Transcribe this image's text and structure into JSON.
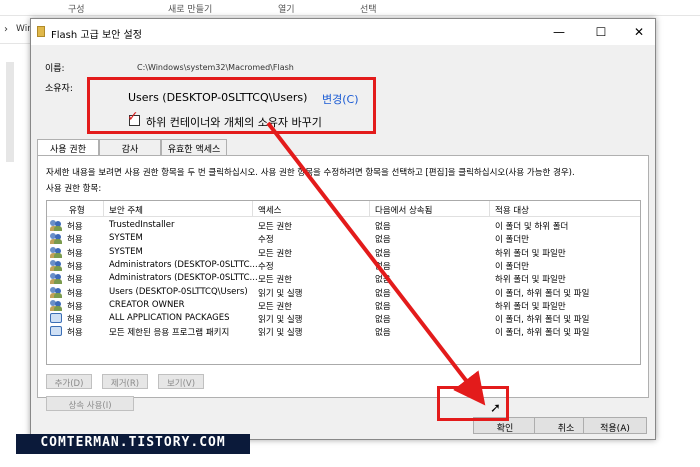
{
  "background": {
    "ribbon": [
      "구성",
      "새로 만들기",
      "열기",
      "선택"
    ],
    "address_fragment": "Wir"
  },
  "dialog": {
    "title": "Flash 고급 보안 설정",
    "name_label": "이름:",
    "name_value": "C:\\Windows\\system32\\Macromed\\Flash",
    "owner_label": "소유자:",
    "owner_value": "Users (DESKTOP-0SLTTCQ\\Users)",
    "owner_change_link": "변경(C)",
    "replace_owner_checkbox": {
      "label": "하위 컨테이너와 개체의 소유자 바꾸기",
      "checked": true
    },
    "tabs": [
      "사용 권한",
      "감사",
      "유효한 액세스"
    ],
    "active_tab": "사용 권한",
    "description": "자세한 내용을 보려면 사용 권한 항목을 두 번 클릭하십시오. 사용 권한 항목을 수정하려면 항목을 선택하고 [편집]을 클릭하십시오(사용 가능한 경우).",
    "entries_label": "사용 권한 항목:",
    "table": {
      "headers": [
        "유형",
        "보안 주체",
        "액세스",
        "다음에서 상속됨",
        "적용 대상"
      ],
      "rows": [
        {
          "icon": "users-icon",
          "type": "허용",
          "principal": "TrustedInstaller",
          "access": "모든 권한",
          "inherited": "없음",
          "applies": "이 폴더 및 하위 폴더"
        },
        {
          "icon": "users-icon",
          "type": "허용",
          "principal": "SYSTEM",
          "access": "수정",
          "inherited": "없음",
          "applies": "이 폴더만"
        },
        {
          "icon": "users-icon",
          "type": "허용",
          "principal": "SYSTEM",
          "access": "모든 권한",
          "inherited": "없음",
          "applies": "하위 폴더 및 파일만"
        },
        {
          "icon": "users-icon",
          "type": "허용",
          "principal": "Administrators (DESKTOP-0SLTTC...",
          "access": "수정",
          "inherited": "없음",
          "applies": "이 폴더만"
        },
        {
          "icon": "users-icon",
          "type": "허용",
          "principal": "Administrators (DESKTOP-0SLTTC...",
          "access": "모든 권한",
          "inherited": "없음",
          "applies": "하위 폴더 및 파일만"
        },
        {
          "icon": "users-icon",
          "type": "허용",
          "principal": "Users (DESKTOP-0SLTTCQ\\Users)",
          "access": "읽기 및 실행",
          "inherited": "없음",
          "applies": "이 폴더, 하위 폴더 및 파일"
        },
        {
          "icon": "users-icon",
          "type": "허용",
          "principal": "CREATOR OWNER",
          "access": "모든 권한",
          "inherited": "없음",
          "applies": "하위 폴더 및 파일만"
        },
        {
          "icon": "network-icon",
          "type": "허용",
          "principal": "ALL APPLICATION PACKAGES",
          "access": "읽기 및 실행",
          "inherited": "없음",
          "applies": "이 폴더, 하위 폴더 및 파일"
        },
        {
          "icon": "network-icon",
          "type": "허용",
          "principal": "모든 제한된 응용 프로그램 패키지",
          "access": "읽기 및 실행",
          "inherited": "없음",
          "applies": "이 폴더, 하위 폴더 및 파일"
        }
      ]
    },
    "panel_buttons": {
      "add": "추가(D)",
      "remove": "제거(R)",
      "view": "보기(V)",
      "disable_inheritance": "상속 사용(I)"
    },
    "buttons": {
      "ok": "확인",
      "cancel": "취소",
      "apply": "적용(A)"
    }
  },
  "watermark": "COMTERMAN.TISTORY.COM",
  "colors": {
    "highlight": "#e31b1b",
    "link": "#1a5bd4",
    "watermark_bg": "#0b1a3a"
  }
}
